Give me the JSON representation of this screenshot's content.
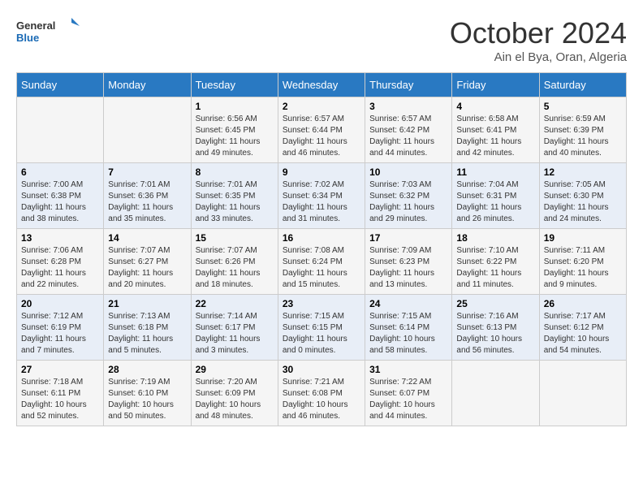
{
  "logo": {
    "line1": "General",
    "line2": "Blue"
  },
  "title": "October 2024",
  "location": "Ain el Bya, Oran, Algeria",
  "days_of_week": [
    "Sunday",
    "Monday",
    "Tuesday",
    "Wednesday",
    "Thursday",
    "Friday",
    "Saturday"
  ],
  "weeks": [
    [
      {
        "day": "",
        "info": ""
      },
      {
        "day": "",
        "info": ""
      },
      {
        "day": "1",
        "info": "Sunrise: 6:56 AM\nSunset: 6:45 PM\nDaylight: 11 hours and 49 minutes."
      },
      {
        "day": "2",
        "info": "Sunrise: 6:57 AM\nSunset: 6:44 PM\nDaylight: 11 hours and 46 minutes."
      },
      {
        "day": "3",
        "info": "Sunrise: 6:57 AM\nSunset: 6:42 PM\nDaylight: 11 hours and 44 minutes."
      },
      {
        "day": "4",
        "info": "Sunrise: 6:58 AM\nSunset: 6:41 PM\nDaylight: 11 hours and 42 minutes."
      },
      {
        "day": "5",
        "info": "Sunrise: 6:59 AM\nSunset: 6:39 PM\nDaylight: 11 hours and 40 minutes."
      }
    ],
    [
      {
        "day": "6",
        "info": "Sunrise: 7:00 AM\nSunset: 6:38 PM\nDaylight: 11 hours and 38 minutes."
      },
      {
        "day": "7",
        "info": "Sunrise: 7:01 AM\nSunset: 6:36 PM\nDaylight: 11 hours and 35 minutes."
      },
      {
        "day": "8",
        "info": "Sunrise: 7:01 AM\nSunset: 6:35 PM\nDaylight: 11 hours and 33 minutes."
      },
      {
        "day": "9",
        "info": "Sunrise: 7:02 AM\nSunset: 6:34 PM\nDaylight: 11 hours and 31 minutes."
      },
      {
        "day": "10",
        "info": "Sunrise: 7:03 AM\nSunset: 6:32 PM\nDaylight: 11 hours and 29 minutes."
      },
      {
        "day": "11",
        "info": "Sunrise: 7:04 AM\nSunset: 6:31 PM\nDaylight: 11 hours and 26 minutes."
      },
      {
        "day": "12",
        "info": "Sunrise: 7:05 AM\nSunset: 6:30 PM\nDaylight: 11 hours and 24 minutes."
      }
    ],
    [
      {
        "day": "13",
        "info": "Sunrise: 7:06 AM\nSunset: 6:28 PM\nDaylight: 11 hours and 22 minutes."
      },
      {
        "day": "14",
        "info": "Sunrise: 7:07 AM\nSunset: 6:27 PM\nDaylight: 11 hours and 20 minutes."
      },
      {
        "day": "15",
        "info": "Sunrise: 7:07 AM\nSunset: 6:26 PM\nDaylight: 11 hours and 18 minutes."
      },
      {
        "day": "16",
        "info": "Sunrise: 7:08 AM\nSunset: 6:24 PM\nDaylight: 11 hours and 15 minutes."
      },
      {
        "day": "17",
        "info": "Sunrise: 7:09 AM\nSunset: 6:23 PM\nDaylight: 11 hours and 13 minutes."
      },
      {
        "day": "18",
        "info": "Sunrise: 7:10 AM\nSunset: 6:22 PM\nDaylight: 11 hours and 11 minutes."
      },
      {
        "day": "19",
        "info": "Sunrise: 7:11 AM\nSunset: 6:20 PM\nDaylight: 11 hours and 9 minutes."
      }
    ],
    [
      {
        "day": "20",
        "info": "Sunrise: 7:12 AM\nSunset: 6:19 PM\nDaylight: 11 hours and 7 minutes."
      },
      {
        "day": "21",
        "info": "Sunrise: 7:13 AM\nSunset: 6:18 PM\nDaylight: 11 hours and 5 minutes."
      },
      {
        "day": "22",
        "info": "Sunrise: 7:14 AM\nSunset: 6:17 PM\nDaylight: 11 hours and 3 minutes."
      },
      {
        "day": "23",
        "info": "Sunrise: 7:15 AM\nSunset: 6:15 PM\nDaylight: 11 hours and 0 minutes."
      },
      {
        "day": "24",
        "info": "Sunrise: 7:15 AM\nSunset: 6:14 PM\nDaylight: 10 hours and 58 minutes."
      },
      {
        "day": "25",
        "info": "Sunrise: 7:16 AM\nSunset: 6:13 PM\nDaylight: 10 hours and 56 minutes."
      },
      {
        "day": "26",
        "info": "Sunrise: 7:17 AM\nSunset: 6:12 PM\nDaylight: 10 hours and 54 minutes."
      }
    ],
    [
      {
        "day": "27",
        "info": "Sunrise: 7:18 AM\nSunset: 6:11 PM\nDaylight: 10 hours and 52 minutes."
      },
      {
        "day": "28",
        "info": "Sunrise: 7:19 AM\nSunset: 6:10 PM\nDaylight: 10 hours and 50 minutes."
      },
      {
        "day": "29",
        "info": "Sunrise: 7:20 AM\nSunset: 6:09 PM\nDaylight: 10 hours and 48 minutes."
      },
      {
        "day": "30",
        "info": "Sunrise: 7:21 AM\nSunset: 6:08 PM\nDaylight: 10 hours and 46 minutes."
      },
      {
        "day": "31",
        "info": "Sunrise: 7:22 AM\nSunset: 6:07 PM\nDaylight: 10 hours and 44 minutes."
      },
      {
        "day": "",
        "info": ""
      },
      {
        "day": "",
        "info": ""
      }
    ]
  ]
}
